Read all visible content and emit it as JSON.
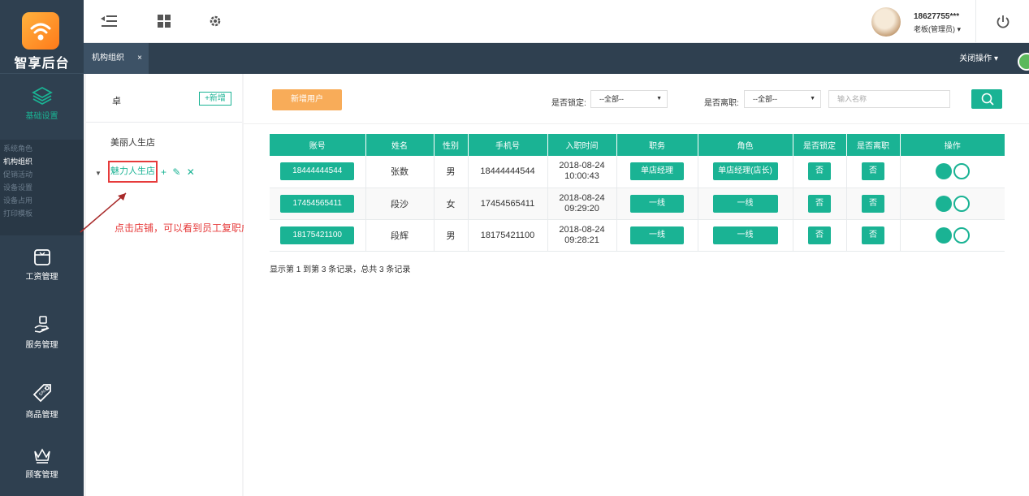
{
  "app": {
    "logo_text": "智享后台"
  },
  "sidebar": {
    "basic": {
      "label": "基础设置"
    },
    "submenu": [
      "系统角色",
      "机构组织",
      "促销活动",
      "设备设置",
      "设备占用",
      "打印模板"
    ],
    "submenu_active": "机构组织",
    "salary": {
      "label": "工资管理"
    },
    "service": {
      "label": "服务管理"
    },
    "goods": {
      "label": "商品管理"
    },
    "member": {
      "label": "顾客管理"
    }
  },
  "user": {
    "name": "18627755***",
    "role": "老板(管理员)"
  },
  "tabs": [
    {
      "label": "机构组织",
      "close": "×"
    }
  ],
  "close_ops": "关闭操作",
  "tree": {
    "title": "卓",
    "add_button": "+新增",
    "nodes": [
      {
        "label": "美丽人生店"
      },
      {
        "label": "魅力人生店"
      }
    ]
  },
  "annotation": "点击店铺，可以看到员工复职成功",
  "toolbar": {
    "new_user": "新增用户",
    "locked_label": "是否锁定:",
    "locked_value": "--全部--",
    "resigned_label": "是否离职:",
    "resigned_value": "--全部--",
    "search_placeholder": "输入名称"
  },
  "table": {
    "headers": [
      "账号",
      "姓名",
      "性别",
      "手机号",
      "入职时间",
      "职务",
      "角色",
      "是否锁定",
      "是否离职",
      "操作"
    ],
    "rows": [
      {
        "account": "18444444544",
        "name": "张数",
        "gender": "男",
        "phone": "18444444544",
        "date": "2018-08-24",
        "time": "10:00:43",
        "position": "单店经理",
        "role": "单店经理(店长)",
        "locked": "否",
        "resigned": "否"
      },
      {
        "account": "17454565411",
        "name": "段沙",
        "gender": "女",
        "phone": "17454565411",
        "date": "2018-08-24",
        "time": "09:29:20",
        "position": "一线",
        "role": "一线",
        "locked": "否",
        "resigned": "否"
      },
      {
        "account": "18175421100",
        "name": "段辉",
        "gender": "男",
        "phone": "18175421100",
        "date": "2018-08-24",
        "time": "09:28:21",
        "position": "一线",
        "role": "一线",
        "locked": "否",
        "resigned": "否"
      }
    ]
  },
  "pager": "显示第 1 到第 3 条记录，总共 3 条记录",
  "colors": {
    "accent": "#1ab394",
    "sidebar": "#2f4050",
    "warning": "#f8ac59",
    "annotation": "#e63b3b"
  }
}
